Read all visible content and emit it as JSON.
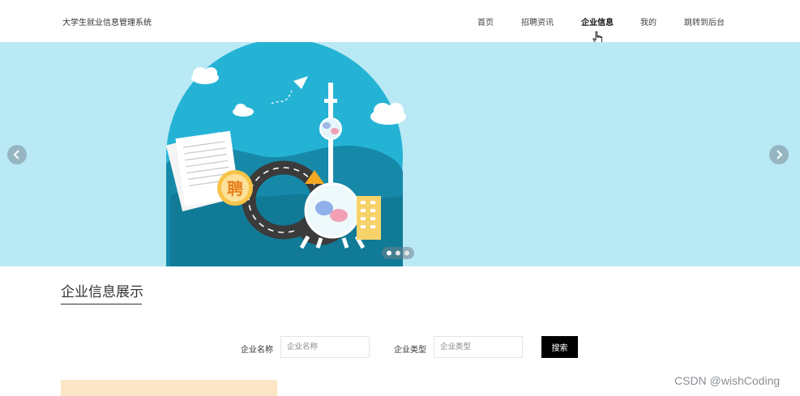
{
  "header": {
    "brand": "大学生就业信息管理系统",
    "nav": [
      {
        "label": "首页",
        "active": false
      },
      {
        "label": "招聘资讯",
        "active": false
      },
      {
        "label": "企业信息",
        "active": true
      },
      {
        "label": "我的",
        "active": false
      },
      {
        "label": "跳转到后台",
        "active": false
      }
    ]
  },
  "banner": {
    "badge_char": "聘",
    "colors": {
      "background": "#b9e9f5",
      "circle": "#25b3d5"
    }
  },
  "section": {
    "title": "企业信息展示"
  },
  "search": {
    "name_label": "企业名称",
    "name_placeholder": "企业名称",
    "type_label": "企业类型",
    "type_placeholder": "企业类型",
    "button_label": "搜索"
  },
  "watermark": "CSDN @wishCoding"
}
